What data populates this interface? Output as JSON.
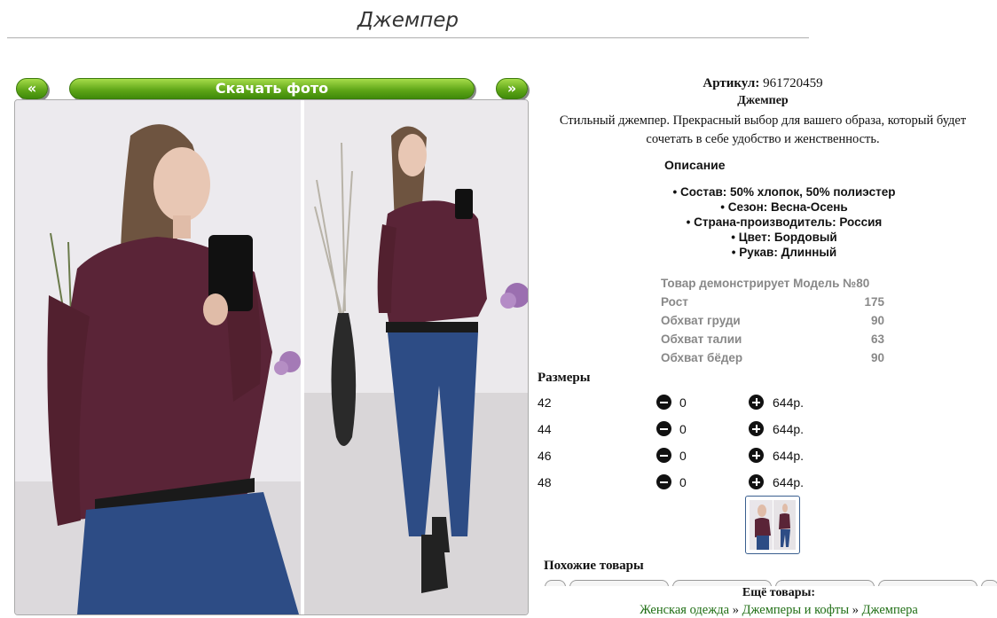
{
  "page": {
    "title": "Джемпер"
  },
  "gallery": {
    "prev_label": "«",
    "next_label": "»",
    "download_label": "Скачать фото"
  },
  "product": {
    "article_label": "Артикул:",
    "article_value": "961720459",
    "name": "Джемпер",
    "description_line1": "Стильный джемпер. Прекрасный выбор для вашего образа, который будет",
    "description_line2": "сочетать в себе удобство и женственность."
  },
  "description": {
    "heading": "Описание",
    "items": [
      "Состав: 50% хлопок, 50% полиэстер",
      "Сезон: Весна-Осень",
      "Страна-производитель: Россия",
      "Цвет: Бордовый",
      "Рукав: Длинный"
    ]
  },
  "model": {
    "title": "Товар демонстрирует Модель №80",
    "rows": [
      {
        "label": "Рост",
        "value": "175"
      },
      {
        "label": "Обхват груди",
        "value": "90"
      },
      {
        "label": "Обхват талии",
        "value": "63"
      },
      {
        "label": "Обхват бёдер",
        "value": "90"
      }
    ]
  },
  "sizes": {
    "title": "Размеры",
    "rows": [
      {
        "size": "42",
        "qty": "0",
        "price": "644р."
      },
      {
        "size": "44",
        "qty": "0",
        "price": "644р."
      },
      {
        "size": "46",
        "qty": "0",
        "price": "644р."
      },
      {
        "size": "48",
        "qty": "0",
        "price": "644р."
      }
    ]
  },
  "similar": {
    "title": "Похожие товары"
  },
  "more": {
    "title": "Ещё товары:",
    "crumbs": [
      "Женская одежда",
      "Джемперы и кофты",
      "Джемпера"
    ],
    "separator": "»"
  },
  "colors": {
    "button_green": "#5ca416",
    "link_green": "#1f6e14",
    "garment": "#5a2437",
    "jeans": "#2d4c85"
  },
  "icons": [
    "minus-circle-icon",
    "plus-circle-icon"
  ]
}
